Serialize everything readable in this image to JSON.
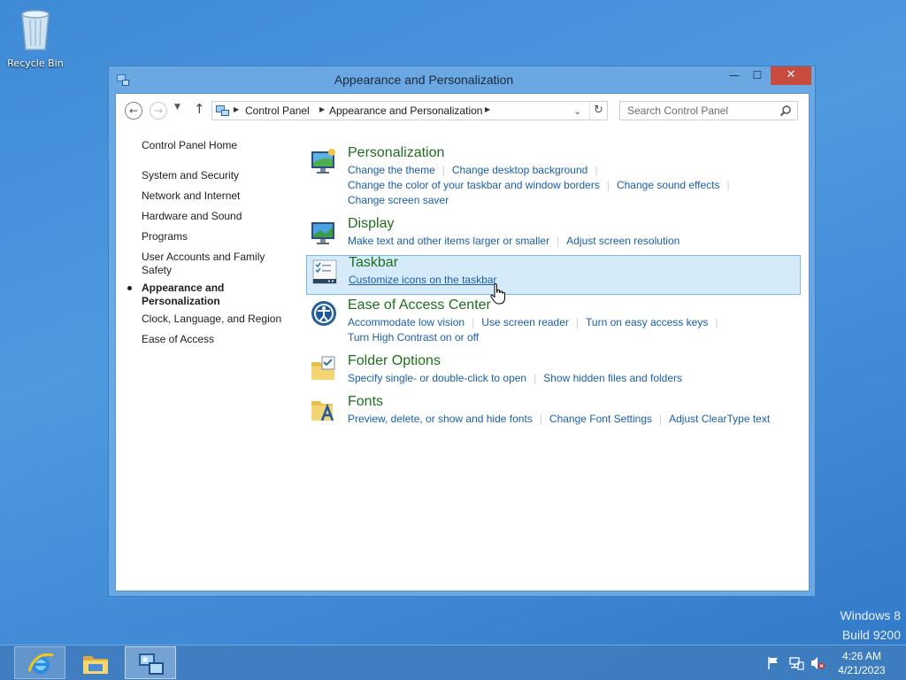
{
  "desktop": {
    "recycle_bin_label": "Recycle Bin",
    "watermark_line1": "Windows 8",
    "watermark_line2": "Build 9200"
  },
  "window": {
    "title": "Appearance and Personalization",
    "minimize_glyph": "—",
    "maximize_glyph": "☐",
    "close_glyph": "✕"
  },
  "address_bar": {
    "back_glyph": "←",
    "forward_glyph": "→",
    "recent_glyph": "▼",
    "up_glyph": "↑",
    "crumbs": [
      "Control Panel",
      "Appearance and Personalization"
    ],
    "crumb_separator": "▶",
    "dropdown_glyph": "⌄",
    "refresh_glyph": "↻",
    "search_placeholder": "Search Control Panel"
  },
  "leftnav": {
    "home": "Control Panel Home",
    "items": [
      "System and Security",
      "Network and Internet",
      "Hardware and Sound",
      "Programs",
      "User Accounts and Family Safety",
      "Appearance and Personalization",
      "Clock, Language, and Region",
      "Ease of Access"
    ],
    "current_index": 5
  },
  "categories": [
    {
      "title": "Personalization",
      "icon": "personalization-icon",
      "lines": [
        [
          "Change the theme",
          "Change desktop background"
        ],
        [
          "Change the color of your taskbar and window borders",
          "Change sound effects"
        ],
        [
          "Change screen saver"
        ]
      ]
    },
    {
      "title": "Display",
      "icon": "display-icon",
      "lines": [
        [
          "Make text and other items larger or smaller",
          "Adjust screen resolution"
        ]
      ]
    },
    {
      "title": "Taskbar",
      "icon": "taskbar-icon",
      "hovered": true,
      "lines": [
        [
          "Customize icons on the taskbar"
        ]
      ]
    },
    {
      "title": "Ease of Access Center",
      "icon": "ease-of-access-icon",
      "lines": [
        [
          "Accommodate low vision",
          "Use screen reader",
          "Turn on easy access keys"
        ],
        [
          "Turn High Contrast on or off"
        ]
      ]
    },
    {
      "title": "Folder Options",
      "icon": "folder-options-icon",
      "lines": [
        [
          "Specify single- or double-click to open",
          "Show hidden files and folders"
        ]
      ]
    },
    {
      "title": "Fonts",
      "icon": "fonts-icon",
      "lines": [
        [
          "Preview, delete, or show and hide fonts",
          "Change Font Settings",
          "Adjust ClearType text"
        ]
      ]
    }
  ],
  "taskbar": {
    "time": "4:26 AM",
    "date": "4/21/2023"
  },
  "colors": {
    "link": "#1a5ea8",
    "category_title": "#1e6e1e",
    "close_button": "#c74b3e",
    "hover_bg": "#d6ebfa"
  }
}
